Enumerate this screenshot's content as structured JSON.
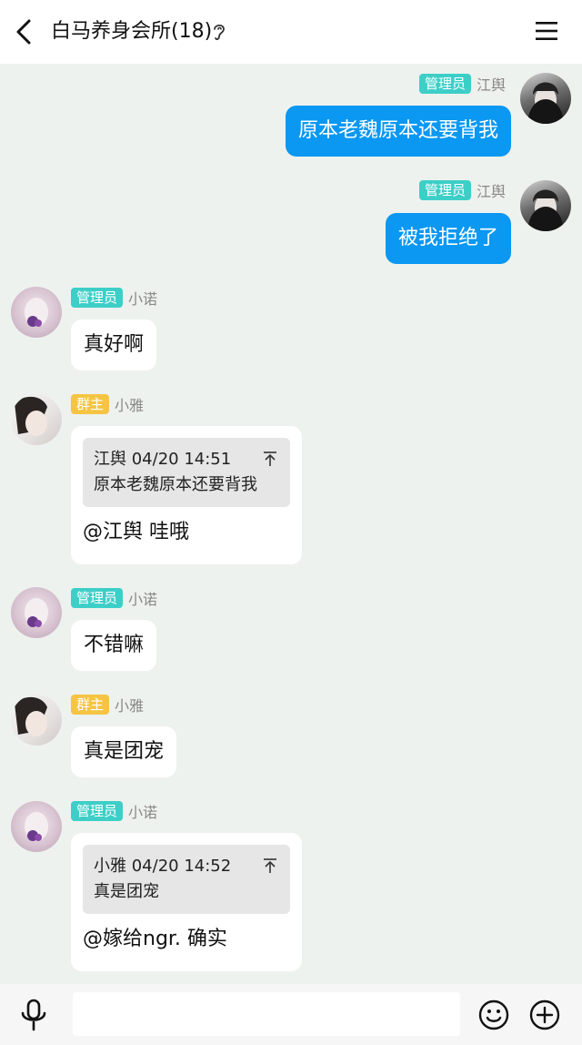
{
  "header": {
    "title": "白马养身会所(18)"
  },
  "colors": {
    "admin_badge": "#3dcfc7",
    "owner_badge": "#f5c443",
    "outgoing_bubble": "#0a98f2"
  },
  "messages": [
    {
      "role": "管理员",
      "sender": "江舆",
      "text": "原本老魏原本还要背我"
    },
    {
      "role": "管理员",
      "sender": "江舆",
      "text": "被我拒绝了"
    },
    {
      "role": "管理员",
      "sender": "小诺",
      "text": "真好啊"
    },
    {
      "role": "群主",
      "sender": "小雅",
      "quote": {
        "header": "江舆 04/20 14:51",
        "text": "原本老魏原本还要背我"
      },
      "text": "@江舆 哇哦"
    },
    {
      "role": "管理员",
      "sender": "小诺",
      "text": "不错嘛"
    },
    {
      "role": "群主",
      "sender": "小雅",
      "text": "真是团宠"
    },
    {
      "role": "管理员",
      "sender": "小诺",
      "quote": {
        "header": "小雅 04/20 14:52",
        "text": "真是团宠"
      },
      "text": "@嫁给ngr. 确实"
    }
  ],
  "input": {
    "placeholder": ""
  },
  "icons": [
    "back-arrow-icon",
    "ear-icon",
    "menu-icon",
    "pin-top-icon",
    "microphone-icon",
    "emoji-icon",
    "plus-icon"
  ]
}
